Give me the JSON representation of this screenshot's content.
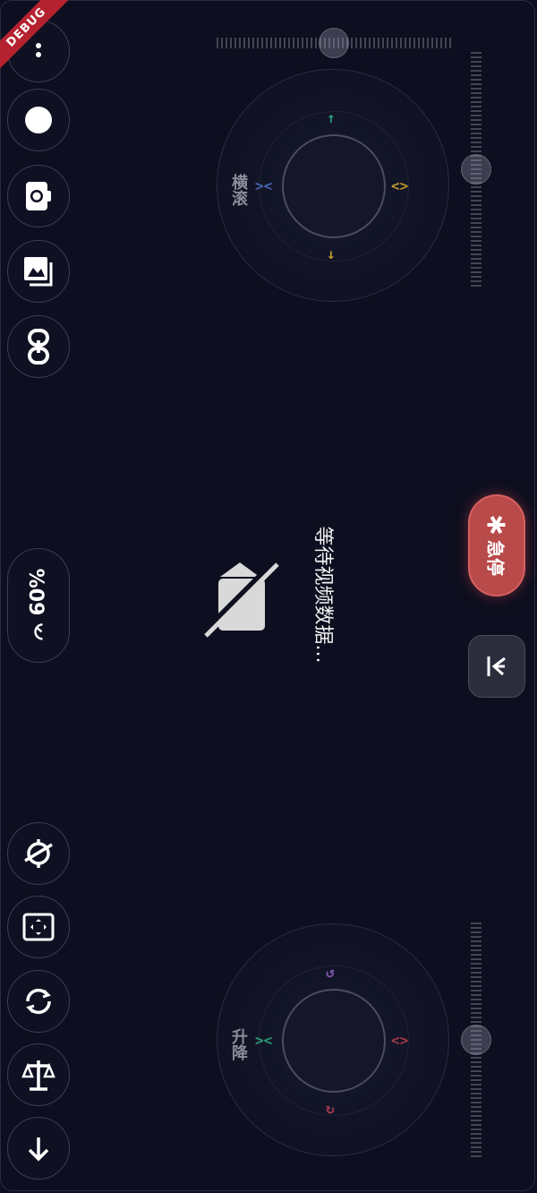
{
  "debug_banner": "DEBUG",
  "speed": {
    "label": "60%",
    "icon": "speedometer-icon"
  },
  "video": {
    "waiting_text": "等待视频数据...",
    "icon": "videocam-off-icon"
  },
  "joystick_right": {
    "label": "横滚"
  },
  "joystick_left": {
    "label": "升降"
  },
  "estop": {
    "label": "急停",
    "icon": "asterisk-icon"
  },
  "left_top_buttons": [
    "more-icon",
    "record-icon",
    "camera-icon",
    "gallery-icon",
    "link-icon"
  ],
  "left_bottom_buttons": [
    "no-gps-icon",
    "fullscreen-icon",
    "rotate-icon",
    "balance-icon",
    "down-arrow-icon"
  ],
  "colors": {
    "background": "#0d0e1f",
    "estop": "#b84a4a",
    "arrow_green": "#2a9a7a",
    "arrow_yellow": "#b8952e",
    "arrow_blue": "#4466aa",
    "arrow_purple": "#7a55aa",
    "arrow_red": "#a03a4a"
  }
}
